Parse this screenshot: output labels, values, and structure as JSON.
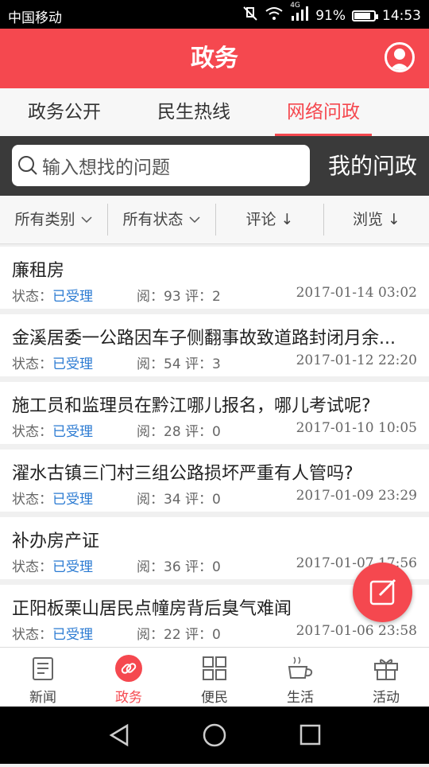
{
  "status_bar": {
    "carrier": "中国移动",
    "network": "4G",
    "battery": "91%",
    "battery_level": 0.91,
    "time": "14:53"
  },
  "header": {
    "title": "政务",
    "accent": "#f5484f"
  },
  "tabs": [
    {
      "label": "政务公开"
    },
    {
      "label": "民生热线"
    },
    {
      "label": "网络问政"
    }
  ],
  "search": {
    "placeholder": "输入想找的问题",
    "my_button": "我的问政"
  },
  "filters": [
    {
      "label": "所有类别",
      "icon": "chevron-down-icon"
    },
    {
      "label": "所有状态",
      "icon": "chevron-down-icon"
    },
    {
      "label": "评论 ↓"
    },
    {
      "label": "浏览 ↓"
    }
  ],
  "items": [
    {
      "title": "廉租房",
      "status_label": "状态：",
      "status": "已受理",
      "stats": "阅：93  评：2",
      "date": "2017-01-14 03:02"
    },
    {
      "title": "金溪居委一公路因车子侧翻事故致道路封闭月余...",
      "status_label": "状态：",
      "status": "已受理",
      "stats": "阅：54  评：3",
      "date": "2017-01-12 22:20"
    },
    {
      "title": "施工员和监理员在黔江哪儿报名，哪儿考试呢?",
      "status_label": "状态：",
      "status": "已受理",
      "stats": "阅：28  评：0",
      "date": "2017-01-10 10:05"
    },
    {
      "title": "濯水古镇三门村三组公路损坏严重有人管吗?",
      "status_label": "状态：",
      "status": "已受理",
      "stats": "阅：34  评：0",
      "date": "2017-01-09 23:29"
    },
    {
      "title": "补办房产证",
      "status_label": "状态：",
      "status": "已受理",
      "stats": "阅：36  评：0",
      "date": "2017-01-07 17:56"
    },
    {
      "title": "正阳板栗山居民点幢房背后臭气难闻",
      "status_label": "状态：",
      "status": "已受理",
      "stats": "阅：22  评：0",
      "date": "2017-01-06 23:58"
    }
  ],
  "bottom_nav": [
    {
      "label": "新闻",
      "icon": "news-icon"
    },
    {
      "label": "政务",
      "icon": "link-icon"
    },
    {
      "label": "便民",
      "icon": "grid-icon"
    },
    {
      "label": "生活",
      "icon": "coffee-icon"
    },
    {
      "label": "活动",
      "icon": "gift-icon"
    }
  ]
}
